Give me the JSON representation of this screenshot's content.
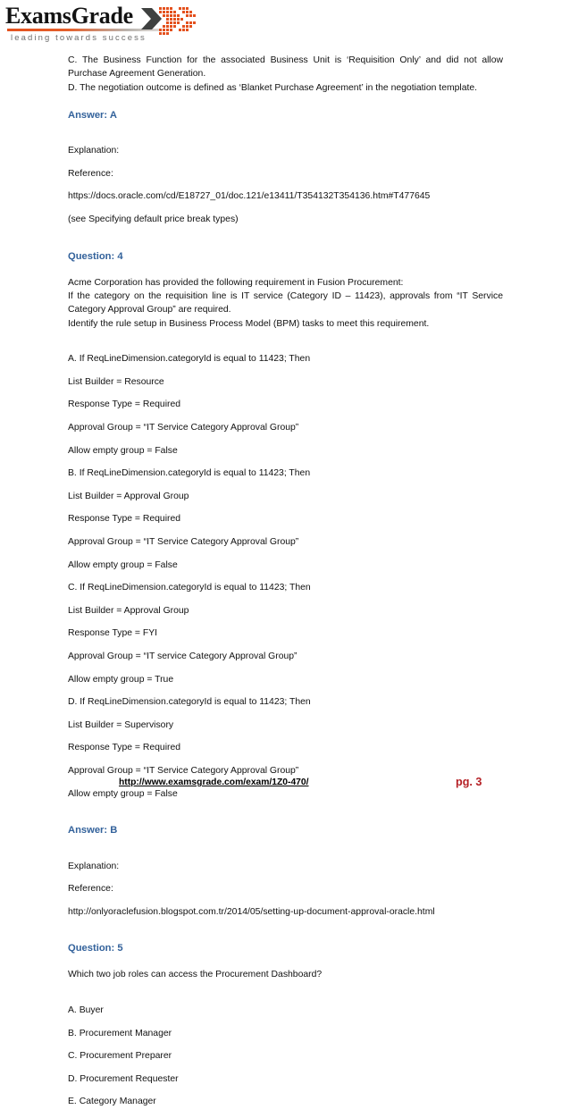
{
  "logo": {
    "wordmark": "ExamsGrade",
    "tagline": "leading towards success",
    "chevron_dark_color": "#3f4140",
    "chevron_orange_color": "#e4511e"
  },
  "colors": {
    "heading_blue": "#33629b",
    "page_number_red": "#b52025",
    "body_text": "#111111"
  },
  "top_options": {
    "option_c": "C. The Business Function for the associated Business Unit is ‘Requisition Only’ and did not allow Purchase Agreement Generation.",
    "option_d": "D. The negotiation outcome is defined as ‘Blanket Purchase Agreement’ in the negotiation template."
  },
  "answer3": {
    "heading": "Answer: A",
    "explanation_label": "Explanation:",
    "reference_label": "Reference:",
    "reference_url": "https://docs.oracle.com/cd/E18727_01/doc.121/e13411/T354132T354136.htm#T477645",
    "reference_note": "(see Specifying default price break types)"
  },
  "question4": {
    "heading": "Question: 4",
    "body_line_1": "Acme Corporation has provided the following requirement in Fusion Procurement:",
    "body_line_2": "If the category on the requisition line is IT service (Category ID – 11423), approvals from “IT Service Category Approval Group” are required.",
    "body_line_3": "Identify the rule setup in Business Process Model (BPM) tasks to meet this requirement.",
    "options": [
      {
        "id": "A",
        "lines": [
          "A. If ReqLineDimension.categoryId is equal to 11423; Then",
          "List Builder = Resource",
          "Response Type = Required",
          "Approval Group = “IT Service Category Approval Group”",
          "Allow empty group = False"
        ]
      },
      {
        "id": "B",
        "lines": [
          "B. If ReqLineDimension.categoryId is equal to 11423; Then",
          "List Builder = Approval Group",
          "Response Type = Required",
          "Approval Group = “IT Service Category Approval Group”",
          "Allow empty group = False"
        ]
      },
      {
        "id": "C",
        "lines": [
          "C. If ReqLineDimension.categoryId is equal to 11423; Then",
          "List Builder = Approval Group",
          "Response Type = FYI",
          "Approval Group = “IT service Category Approval Group”",
          "Allow empty group = True"
        ]
      },
      {
        "id": "D",
        "lines": [
          "D. If ReqLineDimension.categoryId is equal to 11423; Then",
          "List Builder = Supervisory",
          "Response Type = Required",
          "Approval Group = “IT Service Category Approval Group”",
          "Allow empty group = False"
        ]
      }
    ]
  },
  "answer4": {
    "heading": "Answer: B",
    "explanation_label": "Explanation:",
    "reference_label": "Reference:",
    "reference_url": "http://onlyoraclefusion.blogspot.com.tr/2014/05/setting-up-document-approval-oracle.html"
  },
  "question5": {
    "heading": "Question: 5",
    "body": "Which two job roles can access the Procurement Dashboard?",
    "options": [
      "A. Buyer",
      "B. Procurement Manager",
      "C. Procurement Preparer",
      "D. Procurement Requester",
      "E. Category Manager"
    ]
  },
  "footer": {
    "url": "http://www.examsgrade.com/exam/1Z0-470/",
    "page_label": "pg. 3"
  }
}
